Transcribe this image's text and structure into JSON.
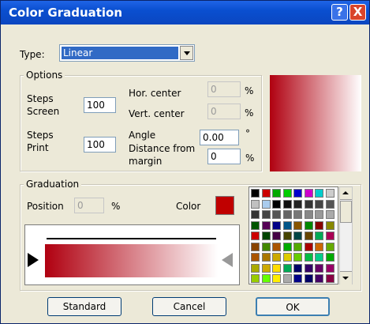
{
  "window": {
    "title": "Color Graduation",
    "help_label": "?",
    "close_label": "X"
  },
  "type_label": "Type:",
  "type_value": "Linear",
  "options": {
    "legend": "Options",
    "steps_screen_label_1": "Steps",
    "steps_screen_label_2": "Screen",
    "steps_screen_value": "100",
    "steps_print_label_1": "Steps",
    "steps_print_label_2": "Print",
    "steps_print_value": "100",
    "hor_center_label": "Hor. center",
    "hor_center_value": "0",
    "hor_center_unit": "%",
    "vert_center_label": "Vert. center",
    "vert_center_value": "0",
    "vert_center_unit": "%",
    "angle_label": "Angle",
    "angle_value": "0.00",
    "angle_unit": "°",
    "distance_label_1": "Distance from",
    "distance_label_2": "margin",
    "distance_value": "0",
    "distance_unit": "%"
  },
  "graduation": {
    "legend": "Graduation",
    "position_label": "Position",
    "position_value": "0",
    "position_unit": "%",
    "color_label": "Color",
    "color_swatch": "#c00000",
    "gradient_start": "#b00010",
    "gradient_end": "#ffffff"
  },
  "palette": [
    [
      "#000000",
      "#cc0000",
      "#00aa00",
      "#00cc00",
      "#0000cc",
      "#cc00cc",
      "#00cccc",
      "#cccccc"
    ],
    [
      "#c0c0c0",
      "#aaccee",
      "#000000",
      "#111111",
      "#222222",
      "#333333",
      "#444444",
      "#555555"
    ],
    [
      "#333333",
      "#444444",
      "#555555",
      "#666666",
      "#777777",
      "#888888",
      "#999999",
      "#aaaaaa"
    ],
    [
      "#005500",
      "#550055",
      "#000088",
      "#005588",
      "#885500",
      "#008800",
      "#880000",
      "#888800"
    ],
    [
      "#cc0000",
      "#004400",
      "#440044",
      "#444400",
      "#004444",
      "#664400",
      "#00aa55",
      "#aa0055"
    ],
    [
      "#884400",
      "#448800",
      "#aa5500",
      "#00aa00",
      "#55aa00",
      "#aa0000",
      "#cc6600",
      "#66aa00"
    ],
    [
      "#aa5500",
      "#aa7700",
      "#ccaa00",
      "#ddcc00",
      "#66cc00",
      "#00bb44",
      "#00cc88",
      "#00aa00"
    ],
    [
      "#aaaa00",
      "#ccaa00",
      "#ffdd00",
      "#00aa55",
      "#000066",
      "#330066",
      "#660066",
      "#990066"
    ],
    [
      "#99cc00",
      "#66ff00",
      "#ffee00",
      "#aaaaaa",
      "#000088",
      "#000066",
      "#440066",
      "#880044"
    ]
  ],
  "buttons": {
    "standard": "Standard",
    "cancel": "Cancel",
    "ok": "OK"
  }
}
